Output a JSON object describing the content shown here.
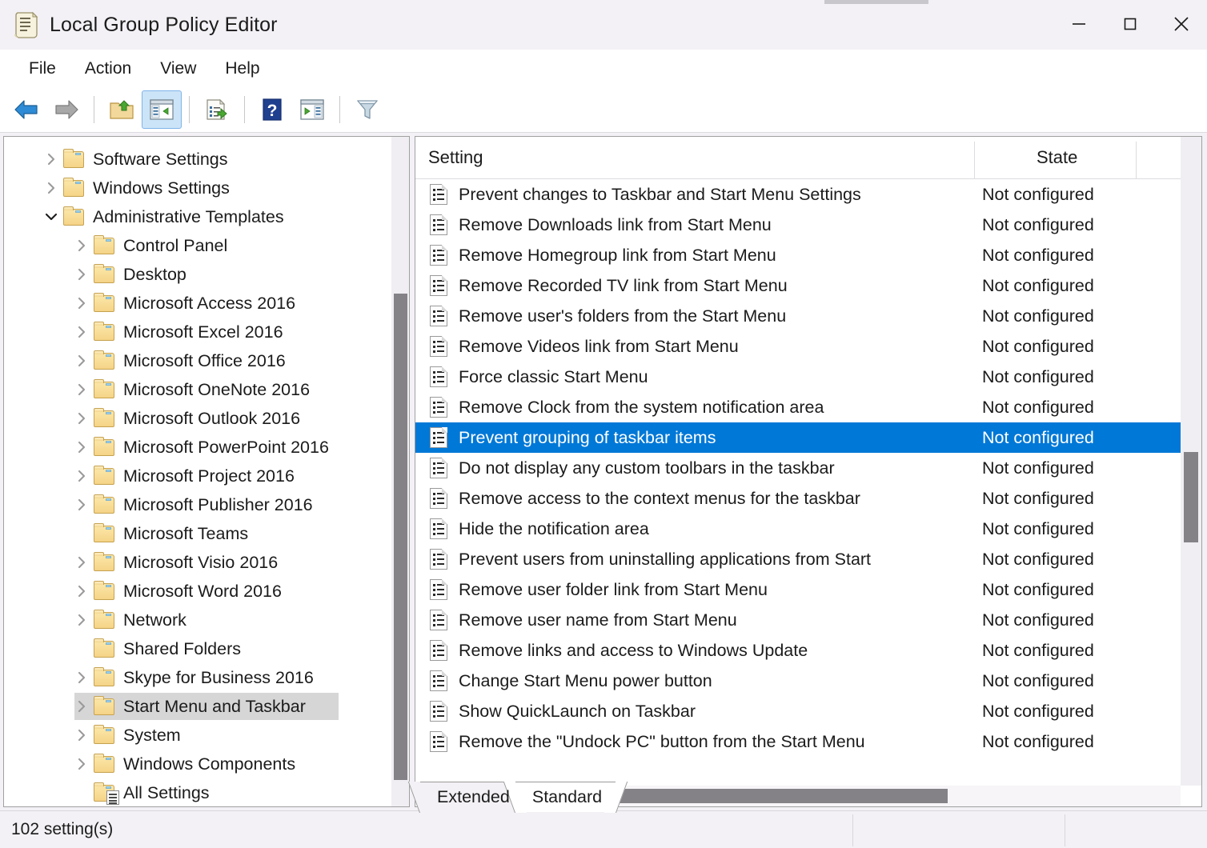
{
  "window": {
    "title": "Local Group Policy Editor",
    "icon": "gpedit-scroll-icon",
    "controls": {
      "minimize": "Minimize",
      "maximize": "Maximize",
      "close": "Close"
    }
  },
  "menubar": {
    "items": [
      "File",
      "Action",
      "View",
      "Help"
    ]
  },
  "toolbar": {
    "buttons": [
      {
        "name": "back-arrow-icon",
        "label": "Back",
        "state": "enabled"
      },
      {
        "name": "forward-arrow-icon",
        "label": "Forward",
        "state": "disabled"
      },
      {
        "name": "up-one-level-icon",
        "label": "Up One Level",
        "state": "enabled"
      },
      {
        "name": "show-hide-console-tree-icon",
        "label": "Show/Hide Console Tree",
        "state": "active"
      },
      {
        "name": "export-list-icon",
        "label": "Export List",
        "state": "enabled"
      },
      {
        "name": "help-icon",
        "label": "Help",
        "state": "enabled"
      },
      {
        "name": "show-action-pane-icon",
        "label": "Show/Hide Action Pane",
        "state": "enabled"
      },
      {
        "name": "filter-icon",
        "label": "Filter Options",
        "state": "enabled"
      }
    ]
  },
  "tree": {
    "items": [
      {
        "label": "Software Settings",
        "depth": 1,
        "expander": "collapsed",
        "icon": "folder-icon",
        "selected": false
      },
      {
        "label": "Windows Settings",
        "depth": 1,
        "expander": "collapsed",
        "icon": "folder-icon",
        "selected": false
      },
      {
        "label": "Administrative Templates",
        "depth": 1,
        "expander": "expanded",
        "icon": "folder-icon",
        "selected": false
      },
      {
        "label": "Control Panel",
        "depth": 2,
        "expander": "collapsed",
        "icon": "folder-icon",
        "selected": false
      },
      {
        "label": "Desktop",
        "depth": 2,
        "expander": "collapsed",
        "icon": "folder-icon",
        "selected": false
      },
      {
        "label": "Microsoft Access 2016",
        "depth": 2,
        "expander": "collapsed",
        "icon": "folder-icon",
        "selected": false
      },
      {
        "label": "Microsoft Excel 2016",
        "depth": 2,
        "expander": "collapsed",
        "icon": "folder-icon",
        "selected": false
      },
      {
        "label": "Microsoft Office 2016",
        "depth": 2,
        "expander": "collapsed",
        "icon": "folder-icon",
        "selected": false
      },
      {
        "label": "Microsoft OneNote 2016",
        "depth": 2,
        "expander": "collapsed",
        "icon": "folder-icon",
        "selected": false
      },
      {
        "label": "Microsoft Outlook 2016",
        "depth": 2,
        "expander": "collapsed",
        "icon": "folder-icon",
        "selected": false
      },
      {
        "label": "Microsoft PowerPoint 2016",
        "depth": 2,
        "expander": "collapsed",
        "icon": "folder-icon",
        "selected": false
      },
      {
        "label": "Microsoft Project 2016",
        "depth": 2,
        "expander": "collapsed",
        "icon": "folder-icon",
        "selected": false
      },
      {
        "label": "Microsoft Publisher 2016",
        "depth": 2,
        "expander": "collapsed",
        "icon": "folder-icon",
        "selected": false
      },
      {
        "label": "Microsoft Teams",
        "depth": 2,
        "expander": "none",
        "icon": "folder-icon",
        "selected": false
      },
      {
        "label": "Microsoft Visio 2016",
        "depth": 2,
        "expander": "collapsed",
        "icon": "folder-icon",
        "selected": false
      },
      {
        "label": "Microsoft Word 2016",
        "depth": 2,
        "expander": "collapsed",
        "icon": "folder-icon",
        "selected": false
      },
      {
        "label": "Network",
        "depth": 2,
        "expander": "collapsed",
        "icon": "folder-icon",
        "selected": false
      },
      {
        "label": "Shared Folders",
        "depth": 2,
        "expander": "none",
        "icon": "folder-icon",
        "selected": false
      },
      {
        "label": "Skype for Business 2016",
        "depth": 2,
        "expander": "collapsed",
        "icon": "folder-icon",
        "selected": false
      },
      {
        "label": "Start Menu and Taskbar",
        "depth": 2,
        "expander": "collapsed",
        "icon": "folder-icon",
        "selected": true
      },
      {
        "label": "System",
        "depth": 2,
        "expander": "collapsed",
        "icon": "folder-icon",
        "selected": false
      },
      {
        "label": "Windows Components",
        "depth": 2,
        "expander": "collapsed",
        "icon": "folder-icon",
        "selected": false
      },
      {
        "label": "All Settings",
        "depth": 2,
        "expander": "none",
        "icon": "all-settings-icon",
        "selected": false
      }
    ]
  },
  "list": {
    "columns": {
      "setting": "Setting",
      "state": "State"
    },
    "rows": [
      {
        "setting": "Prevent changes to Taskbar and Start Menu Settings",
        "state": "Not configured",
        "selected": false
      },
      {
        "setting": "Remove Downloads link from Start Menu",
        "state": "Not configured",
        "selected": false
      },
      {
        "setting": "Remove Homegroup link from Start Menu",
        "state": "Not configured",
        "selected": false
      },
      {
        "setting": "Remove Recorded TV link from Start Menu",
        "state": "Not configured",
        "selected": false
      },
      {
        "setting": "Remove user's folders from the Start Menu",
        "state": "Not configured",
        "selected": false
      },
      {
        "setting": "Remove Videos link from Start Menu",
        "state": "Not configured",
        "selected": false
      },
      {
        "setting": "Force classic Start Menu",
        "state": "Not configured",
        "selected": false
      },
      {
        "setting": "Remove Clock from the system notification area",
        "state": "Not configured",
        "selected": false
      },
      {
        "setting": "Prevent grouping of taskbar items",
        "state": "Not configured",
        "selected": true
      },
      {
        "setting": "Do not display any custom toolbars in the taskbar",
        "state": "Not configured",
        "selected": false
      },
      {
        "setting": "Remove access to the context menus for the taskbar",
        "state": "Not configured",
        "selected": false
      },
      {
        "setting": "Hide the notification area",
        "state": "Not configured",
        "selected": false
      },
      {
        "setting": "Prevent users from uninstalling applications from Start",
        "state": "Not configured",
        "selected": false
      },
      {
        "setting": "Remove user folder link from Start Menu",
        "state": "Not configured",
        "selected": false
      },
      {
        "setting": "Remove user name from Start Menu",
        "state": "Not configured",
        "selected": false
      },
      {
        "setting": "Remove links and access to Windows Update",
        "state": "Not configured",
        "selected": false
      },
      {
        "setting": "Change Start Menu power button",
        "state": "Not configured",
        "selected": false
      },
      {
        "setting": "Show QuickLaunch on Taskbar",
        "state": "Not configured",
        "selected": false
      },
      {
        "setting": "Remove the \"Undock PC\" button from the Start Menu",
        "state": "Not configured",
        "selected": false
      }
    ]
  },
  "tabs": [
    {
      "label": "Extended",
      "active": false
    },
    {
      "label": "Standard",
      "active": true
    }
  ],
  "statusbar": {
    "text": "102 setting(s)"
  },
  "colors": {
    "selection_blue": "#0078d7",
    "tree_selection_gray": "#d6d6d6",
    "scrollbar_thumb": "#858287",
    "window_chrome": "#f3f1f5"
  }
}
